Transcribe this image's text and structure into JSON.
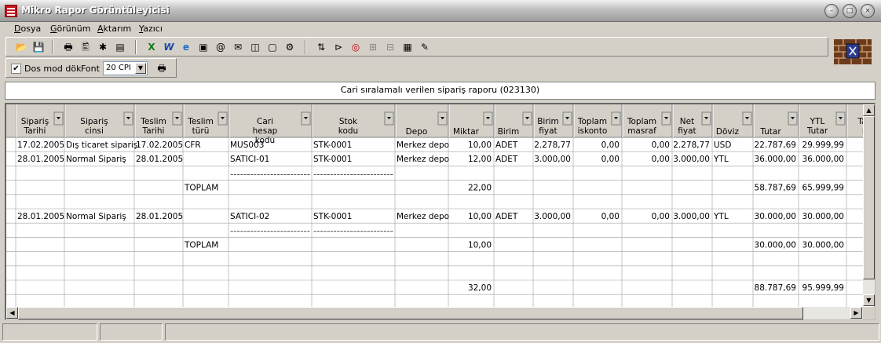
{
  "window": {
    "title": "Mikro Rapor Görüntüleyicisi"
  },
  "menu": [
    "Dosya",
    "Görünüm",
    "Aktarım",
    "Yazıcı"
  ],
  "options": {
    "dos_mode_label": "Dos mod dök",
    "dos_mode_checked": true,
    "font_label": "Font",
    "font_value": "20 CPI"
  },
  "report": {
    "title": "Cari sıralamalı verilen sipariş raporu (023130)",
    "headers": [
      "Sipariş Tarihi",
      "Sipariş cinsi",
      "Teslim Tarihi",
      "Teslim türü",
      "Cari hesap kodu",
      "Stok kodu",
      "Depo",
      "Miktar",
      "Birim",
      "Birim fiyat",
      "Toplam iskonto",
      "Toplam masraf",
      "Net fiyat",
      "Döviz",
      "Tutar",
      "YTL Tutar",
      "Tam m"
    ],
    "rows": [
      [
        "17.02.2005",
        "Dış ticaret siparişi",
        "17.02.2005",
        "CFR",
        "MUS003",
        "STK-0001",
        "Merkez depo",
        "10,00",
        "ADET",
        "2.278,77",
        "0,00",
        "0,00",
        "2.278,77",
        "USD",
        "22.787,69",
        "29.999,99",
        ""
      ],
      [
        "28.01.2005",
        "Normal Sipariş",
        "28.01.2005",
        "",
        "SATICI-01",
        "STK-0001",
        "Merkez depo",
        "12,00",
        "ADET",
        "3.000,00",
        "0,00",
        "0,00",
        "3.000,00",
        "YTL",
        "36.000,00",
        "36.000,00",
        ""
      ],
      [
        "",
        "",
        "",
        "",
        "------------------------",
        "------------------------",
        "",
        "",
        "",
        "",
        "",
        "",
        "",
        "",
        "",
        "",
        ""
      ],
      [
        "",
        "",
        "",
        "TOPLAM",
        "",
        "",
        "",
        "22,00",
        "",
        "",
        "",
        "",
        "",
        "",
        "58.787,69",
        "65.999,99",
        ""
      ],
      [
        "",
        "",
        "",
        "",
        "",
        "",
        "",
        "",
        "",
        "",
        "",
        "",
        "",
        "",
        "",
        "",
        ""
      ],
      [
        "28.01.2005",
        "Normal Sipariş",
        "28.01.2005",
        "",
        "SATICI-02",
        "STK-0001",
        "Merkez depo",
        "10,00",
        "ADET",
        "3.000,00",
        "0,00",
        "0,00",
        "3.000,00",
        "YTL",
        "30.000,00",
        "30.000,00",
        ""
      ],
      [
        "",
        "",
        "",
        "",
        "------------------------",
        "------------------------",
        "",
        "",
        "",
        "",
        "",
        "",
        "",
        "",
        "",
        "",
        ""
      ],
      [
        "",
        "",
        "",
        "TOPLAM",
        "",
        "",
        "",
        "10,00",
        "",
        "",
        "",
        "",
        "",
        "",
        "30.000,00",
        "30.000,00",
        ""
      ],
      [
        "",
        "",
        "",
        "",
        "",
        "",
        "",
        "",
        "",
        "",
        "",
        "",
        "",
        "",
        "",
        "",
        ""
      ],
      [
        "",
        "",
        "",
        "",
        "",
        "",
        "",
        "",
        "",
        "",
        "",
        "",
        "",
        "",
        "",
        "",
        ""
      ],
      [
        "",
        "",
        "",
        "",
        "",
        "",
        "",
        "32,00",
        "",
        "",
        "",
        "",
        "",
        "",
        "88.787,69",
        "95.999,99",
        ""
      ],
      [
        "",
        "",
        "",
        "",
        "",
        "",
        "",
        "",
        "",
        "",
        "",
        "",
        "",
        "",
        "",
        "",
        ""
      ]
    ]
  },
  "toolbar_icons": [
    "open-icon",
    "save-icon",
    "print-icon",
    "print-preview-icon",
    "settings-icon",
    "book-icon",
    "excel-icon",
    "word-icon",
    "ie-icon",
    "export-icon",
    "mail-export-icon",
    "mail-icon",
    "html-icon",
    "document-icon",
    "gear-icon",
    "sort-icon",
    "filter-icon",
    "chart-icon",
    "tree-icon",
    "tree2-icon",
    "note-icon",
    "pen-icon"
  ],
  "status": [
    "",
    "",
    ""
  ]
}
